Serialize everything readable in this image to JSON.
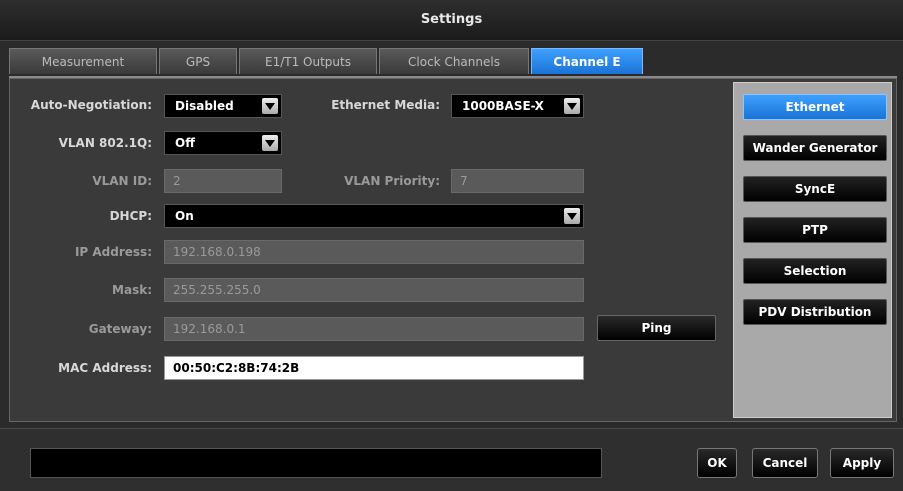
{
  "window": {
    "title": "Settings"
  },
  "tabs": [
    {
      "label": "Measurement"
    },
    {
      "label": "GPS"
    },
    {
      "label": "E1/T1 Outputs"
    },
    {
      "label": "Clock Channels"
    },
    {
      "label": "Channel E",
      "active": true
    }
  ],
  "form": {
    "auto_negotiation": {
      "label": "Auto-Negotiation:",
      "value": "Disabled"
    },
    "ethernet_media": {
      "label": "Ethernet Media:",
      "value": "1000BASE-X"
    },
    "vlan_8021q": {
      "label": "VLAN 802.1Q:",
      "value": "Off"
    },
    "vlan_id": {
      "label": "VLAN ID:",
      "value": "2"
    },
    "vlan_priority": {
      "label": "VLAN Priority:",
      "value": "7"
    },
    "dhcp": {
      "label": "DHCP:",
      "value": "On"
    },
    "ip_address": {
      "label": "IP Address:",
      "value": "192.168.0.198"
    },
    "mask": {
      "label": "Mask:",
      "value": "255.255.255.0"
    },
    "gateway": {
      "label": "Gateway:",
      "value": "192.168.0.1"
    },
    "mac_address": {
      "label": "MAC Address:",
      "value": "00:50:C2:8B:74:2B"
    },
    "ping_label": "Ping"
  },
  "side_menu": [
    {
      "label": "Ethernet",
      "active": true
    },
    {
      "label": "Wander Generator"
    },
    {
      "label": "SyncE"
    },
    {
      "label": "PTP"
    },
    {
      "label": "Selection"
    },
    {
      "label": "PDV Distribution"
    }
  ],
  "footer": {
    "ok_label": "OK",
    "cancel_label": "Cancel",
    "apply_label": "Apply"
  },
  "colors": {
    "accent": "#1a73d6",
    "background": "#2b2b2b"
  }
}
